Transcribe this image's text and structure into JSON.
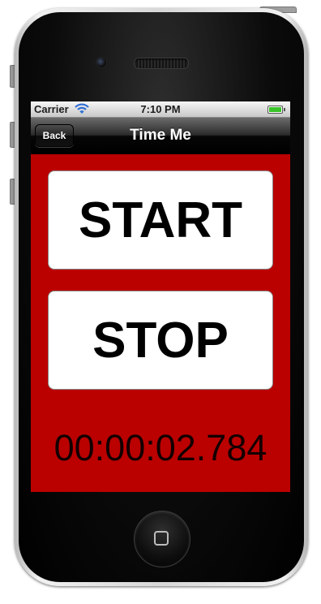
{
  "device": {
    "frame_color": "#d7d7d7",
    "bezel_color": "#0b0b0b"
  },
  "status_bar": {
    "carrier": "Carrier",
    "time": "7:10 PM",
    "wifi_icon": "wifi-icon",
    "battery_icon": "battery-icon",
    "battery_level": 1.0,
    "battery_color": "#3bc42a"
  },
  "nav_bar": {
    "back_label": "Back",
    "title": "Time Me"
  },
  "main": {
    "background_color": "#bb0000",
    "start_label": "START",
    "stop_label": "STOP",
    "timer_value": "00:00:02.784"
  }
}
